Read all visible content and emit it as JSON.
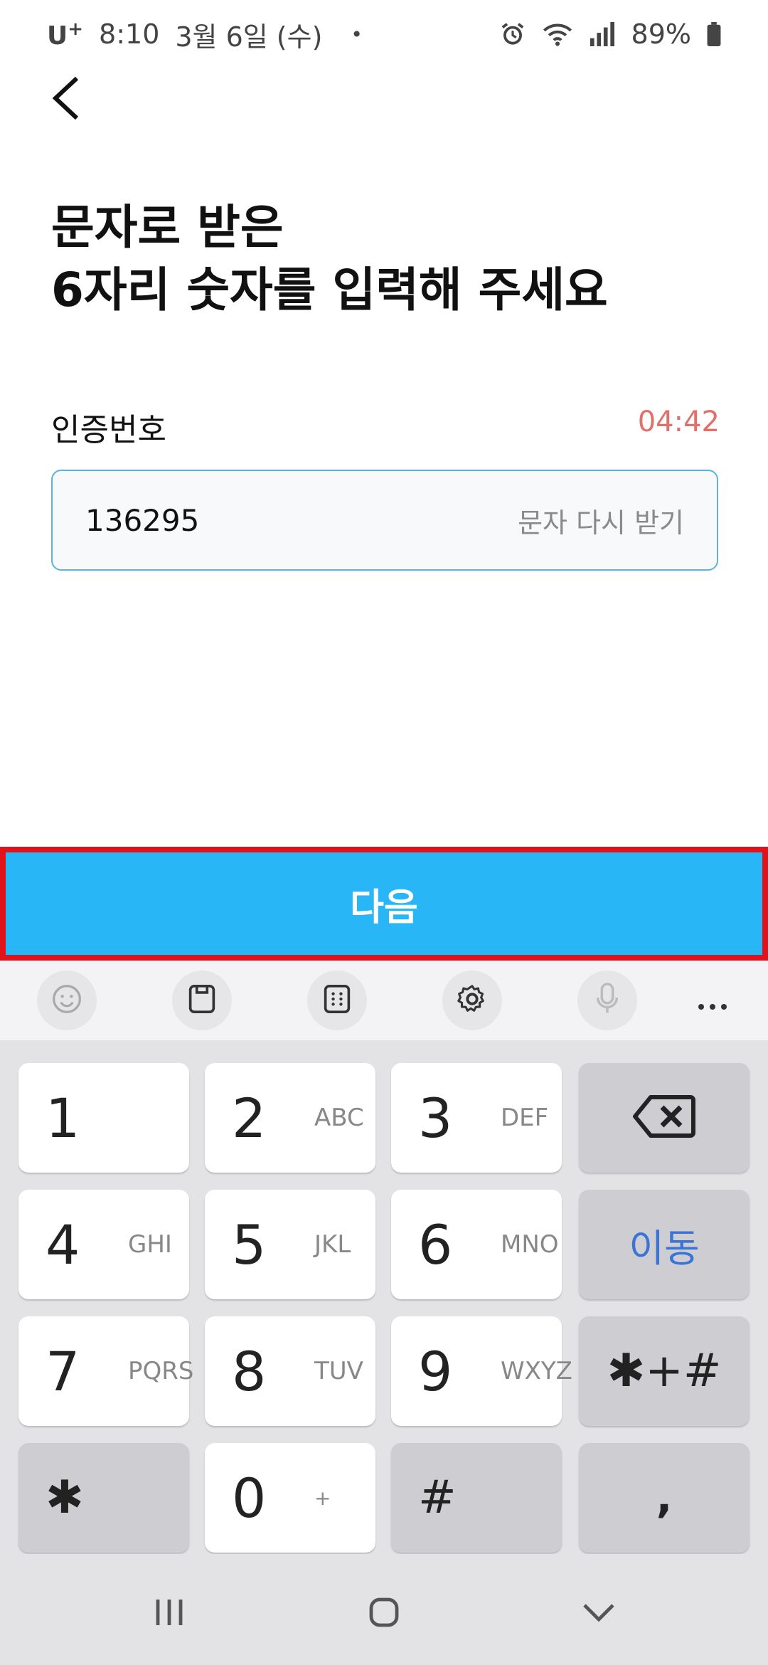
{
  "status_bar": {
    "carrier": "U",
    "carrier_sup": "+",
    "time": "8:10",
    "date": "3월 6일 (수)",
    "dot": "•",
    "battery": "89%"
  },
  "title": {
    "line1": "문자로 받은",
    "line2": "6자리 숫자를 입력해 주세요"
  },
  "field": {
    "label": "인증번호",
    "timer": "04:42",
    "value": "136295",
    "resend": "문자 다시 받기"
  },
  "next_button": {
    "label": "다음"
  },
  "keyboard": {
    "keys": [
      {
        "main": "1",
        "sub": ""
      },
      {
        "main": "2",
        "sub": "ABC"
      },
      {
        "main": "3",
        "sub": "DEF"
      },
      {
        "main": "4",
        "sub": "GHI"
      },
      {
        "main": "5",
        "sub": "JKL"
      },
      {
        "main": "6",
        "sub": "MNO"
      },
      {
        "main": "7",
        "sub": "PQRS"
      },
      {
        "main": "8",
        "sub": "TUV"
      },
      {
        "main": "9",
        "sub": "WXYZ"
      },
      {
        "main": "0",
        "sub": "+"
      }
    ],
    "move_label": "이동",
    "symbols_label": "✱+#",
    "star_label": "✱",
    "hash_label": "#",
    "comma_label": ","
  },
  "colors": {
    "accent": "#29b6f6",
    "highlight_border": "#e0131d",
    "timer": "#e0716a",
    "move_key": "#3a74d6"
  },
  "icons": {
    "back": "chevron-left-icon",
    "emoji": "emoji-icon",
    "clipboard": "clipboard-icon",
    "keypad": "keypad-icon",
    "settings": "gear-icon",
    "mic": "microphone-icon",
    "more": "more-icon",
    "backspace": "backspace-icon",
    "recents": "recents-icon",
    "home": "home-icon",
    "back_nav": "chevron-down-icon"
  }
}
